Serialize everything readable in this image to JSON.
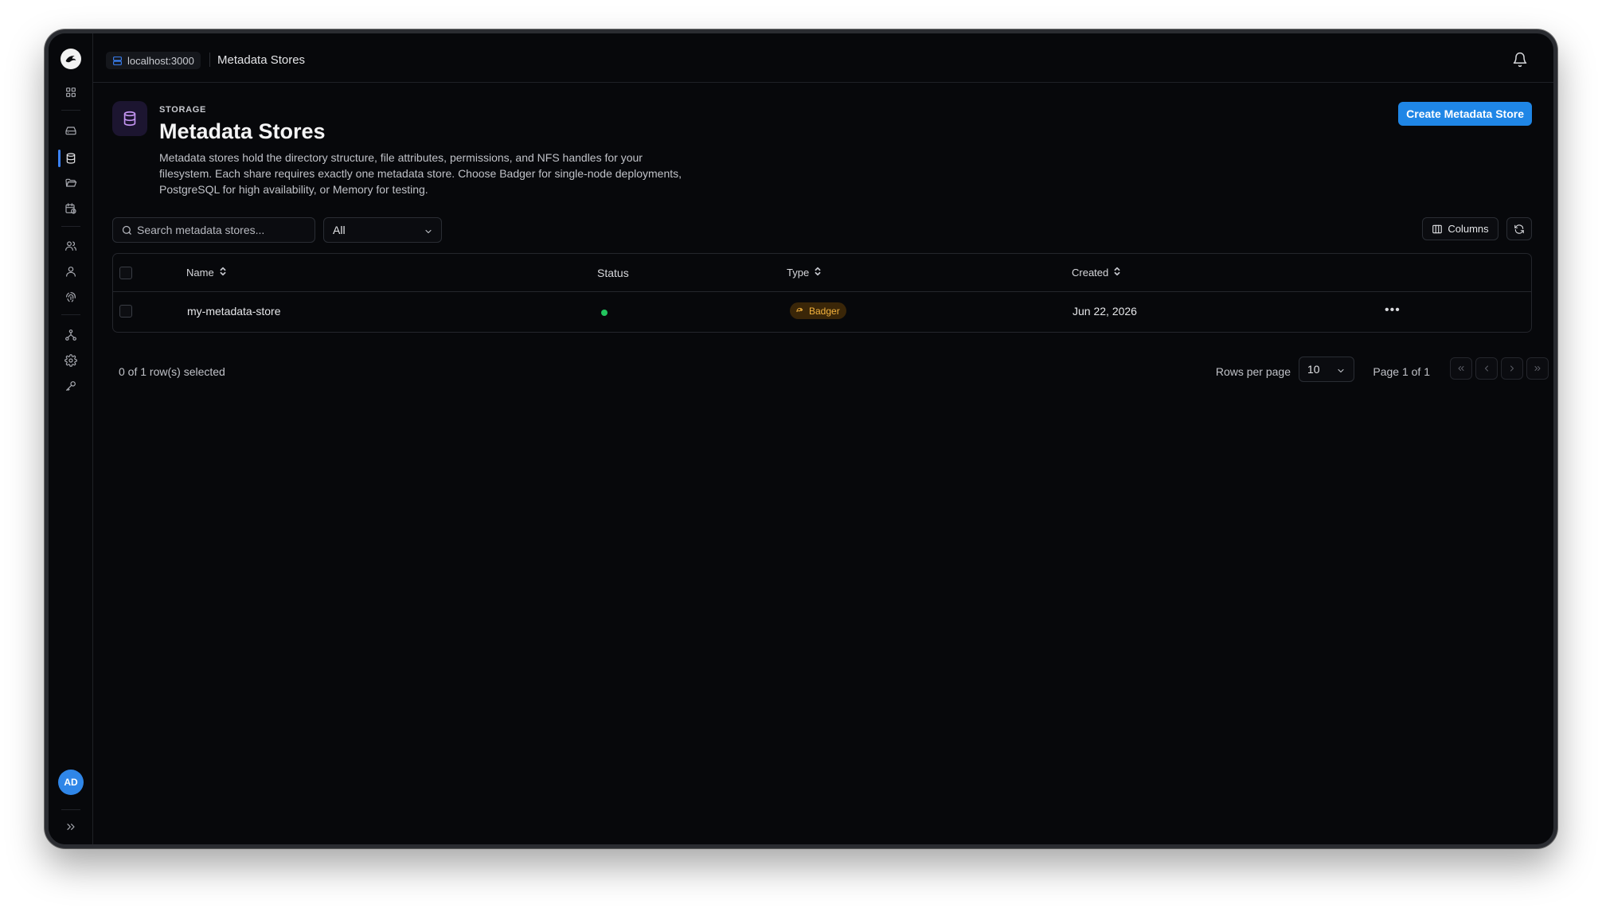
{
  "topbar": {
    "host": "localhost:3000",
    "breadcrumb": "Metadata Stores"
  },
  "sidebar": {
    "items": [
      {
        "name": "dashboard",
        "icon": "grid-icon"
      },
      {
        "name": "storage",
        "icon": "hard-drive-icon"
      },
      {
        "name": "metadata-stores",
        "icon": "database-icon",
        "active": true
      },
      {
        "name": "shares",
        "icon": "folder-open-icon"
      },
      {
        "name": "schedules",
        "icon": "calendar-clock-icon"
      },
      {
        "name": "users",
        "icon": "users-icon"
      },
      {
        "name": "groups",
        "icon": "user-group-icon"
      },
      {
        "name": "identity",
        "icon": "fingerprint-icon"
      },
      {
        "name": "network",
        "icon": "network-icon"
      },
      {
        "name": "settings",
        "icon": "gear-icon"
      },
      {
        "name": "keys",
        "icon": "key-icon"
      }
    ],
    "avatar": "AD"
  },
  "header": {
    "eyebrow": "STORAGE",
    "title": "Metadata Stores",
    "description": "Metadata stores hold the directory structure, file attributes, permissions, and NFS handles for your filesystem. Each share requires exactly one metadata store. Choose Badger for single-node deployments, PostgreSQL for high availability, or Memory for testing.",
    "create_button": "Create Metadata Store"
  },
  "toolbar": {
    "search_placeholder": "Search metadata stores...",
    "filter_value": "All",
    "columns_label": "Columns"
  },
  "table": {
    "columns": [
      "Name",
      "Status",
      "Type",
      "Created"
    ],
    "rows": [
      {
        "name": "my-metadata-store",
        "status": "active",
        "type": "Badger",
        "created": "Jun 22, 2026"
      }
    ]
  },
  "footer": {
    "selection": "0 of 1 row(s) selected",
    "rows_per_page_label": "Rows per page",
    "rows_per_page_value": "10",
    "page_info": "Page 1 of 1"
  },
  "colors": {
    "accent": "#1f86e6",
    "status_active": "#22c55e",
    "badger_badge": "#f3b23d"
  }
}
